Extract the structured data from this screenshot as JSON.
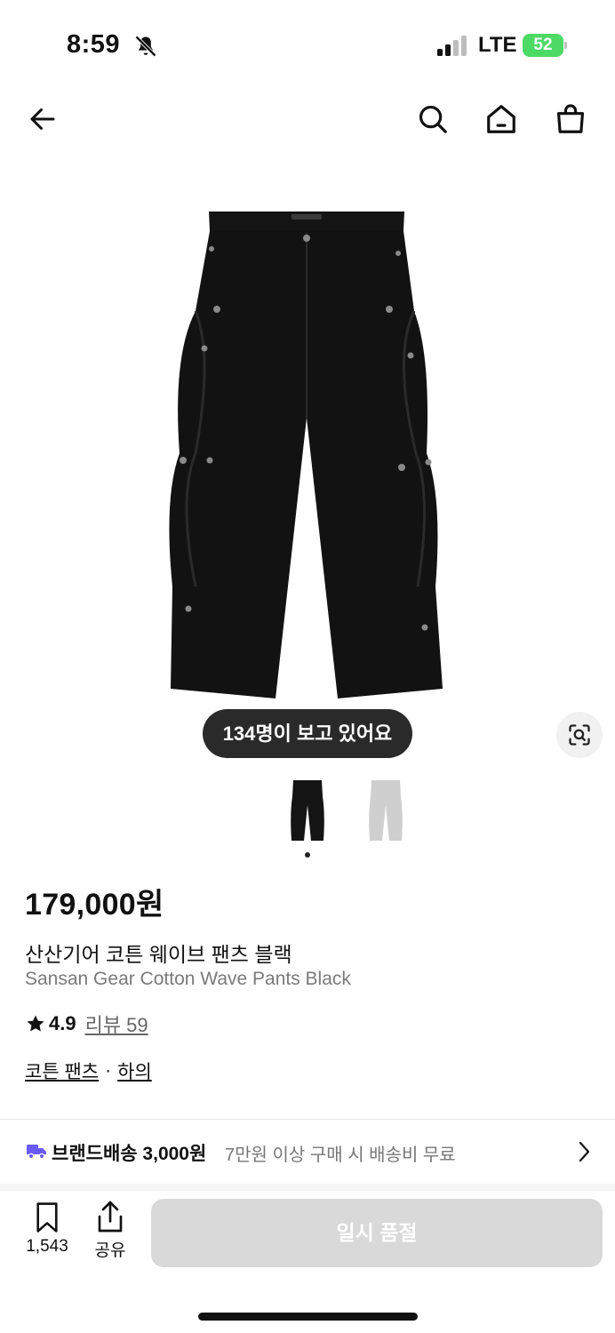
{
  "status_bar": {
    "time": "8:59",
    "network": "LTE",
    "battery": "52"
  },
  "nav": {
    "back_icon": "arrow-left-icon",
    "search_icon": "search-icon",
    "home_icon": "home-icon",
    "bag_icon": "shopping-bag-icon"
  },
  "product": {
    "viewers_text": "134명이 보고 있어요",
    "price": "179,000원",
    "name_ko": "산산기어 코튼 웨이브 팬츠 블랙",
    "name_en": "Sansan Gear Cotton Wave Pants Black",
    "rating": "4.9",
    "reviews_label": "리뷰 59",
    "categories": [
      "코튼 팬츠",
      "하의"
    ],
    "category_separator": "·",
    "thumbnails": [
      {
        "color_name": "black",
        "selected": true
      },
      {
        "color_name": "light-gray",
        "selected": false
      }
    ]
  },
  "shipping": {
    "title": "브랜드배송 3,000원",
    "description": "7만원 이상 구매 시 배송비 무료"
  },
  "bottom_bar": {
    "save_count": "1,543",
    "share_label": "공유",
    "buy_button_label": "일시 품절"
  },
  "colors": {
    "accent_truck": "#6b5bff",
    "soldout_button": "#d9d9d9",
    "battery_green": "#4cd964"
  }
}
